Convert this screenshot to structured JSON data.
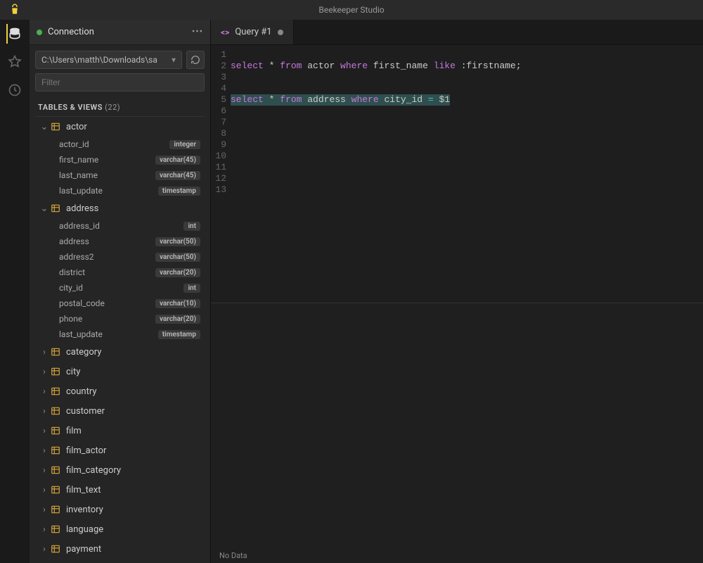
{
  "app": {
    "title": "Beekeeper Studio"
  },
  "connection": {
    "label": "Connection",
    "path": "C:\\Users\\matth\\Downloads\\sa",
    "filter_placeholder": "Filter"
  },
  "section": {
    "label": "TABLES & VIEWS",
    "count": "(22)"
  },
  "tables": [
    {
      "name": "actor",
      "expanded": true,
      "columns": [
        {
          "name": "actor_id",
          "type": "integer"
        },
        {
          "name": "first_name",
          "type": "varchar(45)"
        },
        {
          "name": "last_name",
          "type": "varchar(45)"
        },
        {
          "name": "last_update",
          "type": "timestamp"
        }
      ]
    },
    {
      "name": "address",
      "expanded": true,
      "columns": [
        {
          "name": "address_id",
          "type": "int"
        },
        {
          "name": "address",
          "type": "varchar(50)"
        },
        {
          "name": "address2",
          "type": "varchar(50)"
        },
        {
          "name": "district",
          "type": "varchar(20)"
        },
        {
          "name": "city_id",
          "type": "int"
        },
        {
          "name": "postal_code",
          "type": "varchar(10)"
        },
        {
          "name": "phone",
          "type": "varchar(20)"
        },
        {
          "name": "last_update",
          "type": "timestamp"
        }
      ]
    },
    {
      "name": "category",
      "expanded": false,
      "columns": []
    },
    {
      "name": "city",
      "expanded": false,
      "columns": []
    },
    {
      "name": "country",
      "expanded": false,
      "columns": []
    },
    {
      "name": "customer",
      "expanded": false,
      "columns": []
    },
    {
      "name": "film",
      "expanded": false,
      "columns": []
    },
    {
      "name": "film_actor",
      "expanded": false,
      "columns": []
    },
    {
      "name": "film_category",
      "expanded": false,
      "columns": []
    },
    {
      "name": "film_text",
      "expanded": false,
      "columns": []
    },
    {
      "name": "inventory",
      "expanded": false,
      "columns": []
    },
    {
      "name": "language",
      "expanded": false,
      "columns": []
    },
    {
      "name": "payment",
      "expanded": false,
      "columns": []
    }
  ],
  "tab": {
    "label": "Query #1"
  },
  "editor": {
    "total_lines": 13,
    "lines": {
      "2": [
        {
          "t": "select",
          "c": "kw"
        },
        {
          "t": " * ",
          "c": ""
        },
        {
          "t": "from",
          "c": "kw"
        },
        {
          "t": " actor ",
          "c": ""
        },
        {
          "t": "where",
          "c": "kw"
        },
        {
          "t": " first_name ",
          "c": ""
        },
        {
          "t": "like",
          "c": "kw"
        },
        {
          "t": " :firstname;",
          "c": ""
        }
      ],
      "5": [
        {
          "t": "select",
          "c": "kw"
        },
        {
          "t": " * ",
          "c": ""
        },
        {
          "t": "from",
          "c": "kw"
        },
        {
          "t": " address ",
          "c": ""
        },
        {
          "t": "where",
          "c": "kw"
        },
        {
          "t": " city_id ",
          "c": ""
        },
        {
          "t": "=",
          "c": "op"
        },
        {
          "t": " $1",
          "c": ""
        }
      ]
    },
    "selected_line": 5
  },
  "results": {
    "status": "No Data"
  }
}
